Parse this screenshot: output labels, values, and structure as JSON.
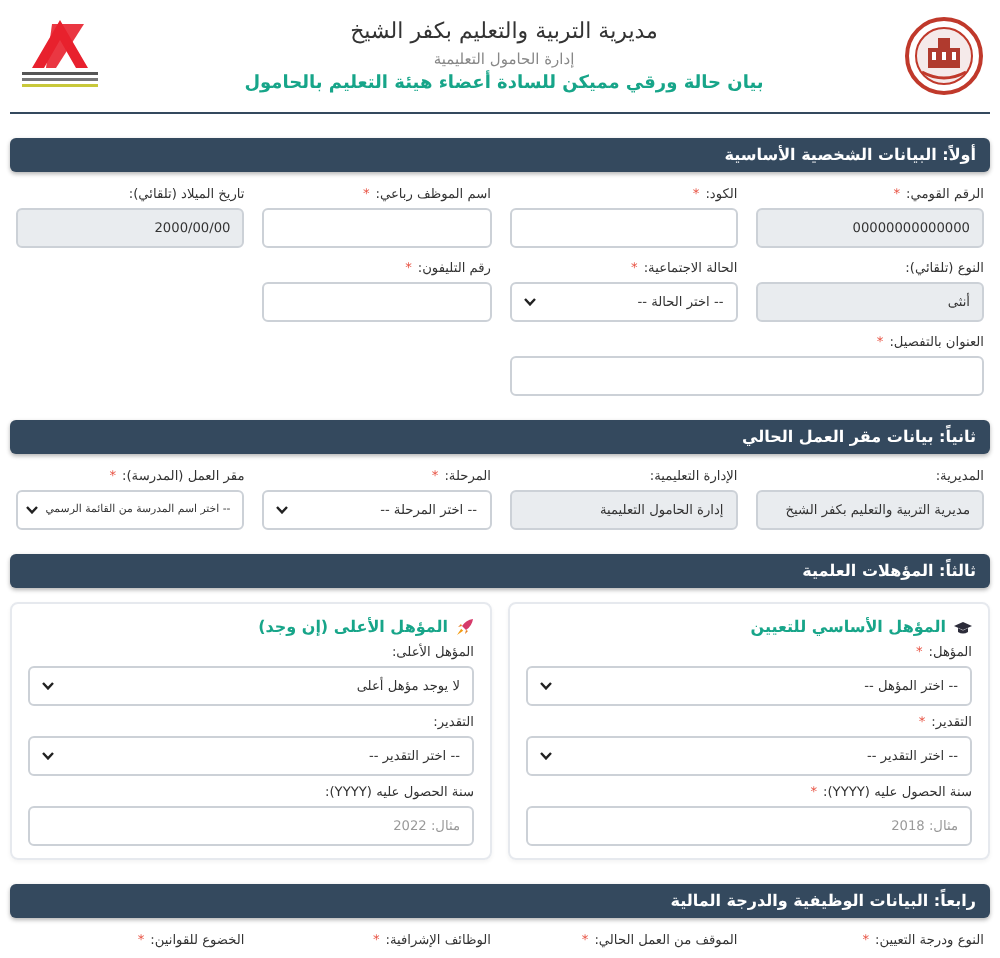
{
  "header": {
    "title": "مديرية التربية والتعليم بكفر الشيخ",
    "subtitle": "إدارة الحامول التعليمية",
    "heading": "بيان حالة ورقي مميكن للسادة أعضاء هيئة التعليم بالحامول"
  },
  "sections": [
    {
      "title": "أولاً: البيانات الشخصية الأساسية",
      "fields": [
        {
          "label": "الرقم القومي:",
          "required_mark": "*",
          "kind": "input",
          "value": "00000000000000",
          "readonly": true
        },
        {
          "label": "الكود:",
          "required_mark": "*",
          "kind": "input",
          "readonly": false
        },
        {
          "label": "اسم الموظف رباعي:",
          "required_mark": "*",
          "kind": "input",
          "readonly": false
        },
        {
          "label": "تاريخ الميلاد (تلقائي):",
          "kind": "input",
          "value": "2000/00/00",
          "readonly": true
        },
        {
          "label": "النوع (تلقائي):",
          "kind": "input",
          "value": "أنثى",
          "readonly": true
        },
        {
          "label": "الحالة الاجتماعية:",
          "required_mark": "*",
          "kind": "select",
          "value": "-- اختر الحالة --"
        },
        {
          "label": "رقم التليفون:",
          "required_mark": "*",
          "kind": "input",
          "readonly": false
        },
        {
          "label": "العنوان بالتفصيل:",
          "required_mark": "*",
          "kind": "wide_input",
          "readonly": false
        }
      ]
    },
    {
      "title": "ثانياً: بيانات مقر العمل الحالي",
      "fields": [
        {
          "label": "المديرية:",
          "kind": "input",
          "value": "مديرية التربية والتعليم بكفر الشيخ",
          "readonly": true
        },
        {
          "label": "الإدارة التعليمية:",
          "kind": "input",
          "value": "إدارة الحامول التعليمية",
          "readonly": true
        },
        {
          "label": "المرحلة:",
          "required_mark": "*",
          "kind": "select",
          "value": "-- اختر المرحلة --"
        },
        {
          "label": "مقر العمل (المدرسة):",
          "required_mark": "*",
          "kind": "select",
          "value": "-- اختر اسم المدرسة من القائمة الرسمي"
        }
      ]
    },
    {
      "title": "ثالثاً: المؤهلات العلمية",
      "cards": [
        {
          "kind": "basic",
          "title": "المؤهل الأساسي للتعيين",
          "fields": [
            {
              "label": "المؤهل:",
              "required_mark": "*",
              "kind": "select",
              "value": "-- اختر المؤهل --"
            },
            {
              "label": "التقدير:",
              "required_mark": "*",
              "kind": "select",
              "value": "-- اختر التقدير --"
            },
            {
              "label": "سنة الحصول عليه (YYYY):",
              "required_mark": "*",
              "kind": "input",
              "placeholder": "مثال: 2018",
              "readonly": false
            }
          ]
        },
        {
          "kind": "higher",
          "title": "المؤهل الأعلى (إن وجد)",
          "fields": [
            {
              "label": "المؤهل الأعلى:",
              "kind": "select",
              "value": "لا يوجد مؤهل أعلى"
            },
            {
              "label": "التقدير:",
              "kind": "select",
              "value": "-- اختر التقدير --"
            },
            {
              "label": "سنة الحصول عليه (YYYY):",
              "kind": "input",
              "placeholder": "مثال: 2022",
              "readonly": false
            }
          ]
        }
      ]
    },
    {
      "title": "رابعاً: البيانات الوظيفية والدرجة المالية",
      "fields": [
        {
          "label": "النوع ودرجة التعيين:",
          "required_mark": "*"
        },
        {
          "label": "الموقف من العمل الحالي:",
          "required_mark": "*"
        },
        {
          "label": "الوظائف الإشرافية:",
          "required_mark": "*"
        },
        {
          "label": "الخضوع للقوانين:",
          "required_mark": "*"
        }
      ]
    }
  ]
}
